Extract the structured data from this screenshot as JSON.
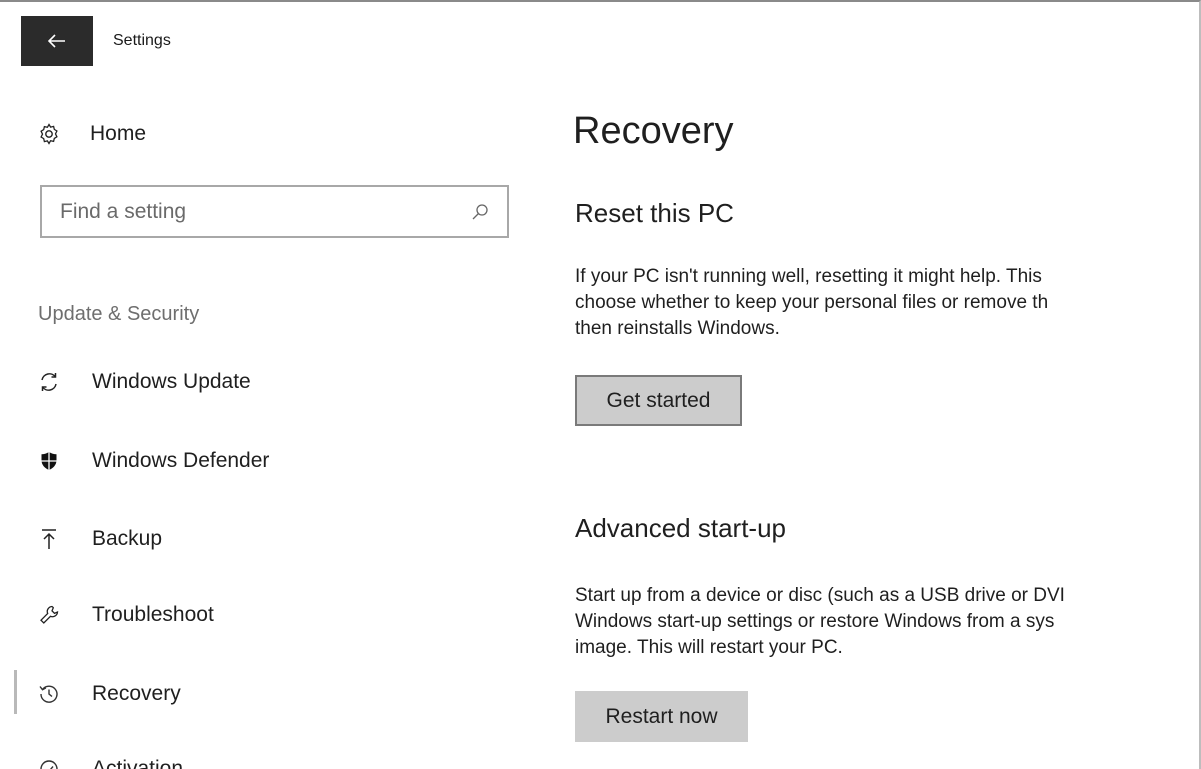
{
  "header": {
    "back_icon": "arrow-left-icon",
    "title": "Settings"
  },
  "sidebar": {
    "home": {
      "label": "Home",
      "icon": "gear-icon"
    },
    "search": {
      "placeholder": "Find a setting",
      "icon": "search-icon"
    },
    "section_label": "Update & Security",
    "items": [
      {
        "label": "Windows Update",
        "icon": "refresh-icon"
      },
      {
        "label": "Windows Defender",
        "icon": "shield-icon"
      },
      {
        "label": "Backup",
        "icon": "upload-arrow-icon"
      },
      {
        "label": "Troubleshoot",
        "icon": "wrench-icon"
      },
      {
        "label": "Recovery",
        "icon": "history-icon",
        "selected": true
      },
      {
        "label": "Activation",
        "icon": "activation-icon"
      }
    ]
  },
  "main": {
    "title": "Recovery",
    "reset": {
      "heading": "Reset this PC",
      "body_lines": [
        "If your PC isn't running well, resetting it might help. This",
        "choose whether to keep your personal files or remove th",
        "then reinstalls Windows."
      ],
      "button": "Get started"
    },
    "advanced": {
      "heading": "Advanced start-up",
      "body_lines": [
        "Start up from a device or disc (such as a USB drive or DVI",
        "Windows start-up settings or restore Windows from a sys",
        "image. This will restart your PC."
      ],
      "button": "Restart now"
    }
  },
  "colors": {
    "back_button_bg": "#2b2b2b",
    "button_bg": "#cccccc",
    "text": "#1f1f1f",
    "muted_text": "#6e6e6e"
  }
}
